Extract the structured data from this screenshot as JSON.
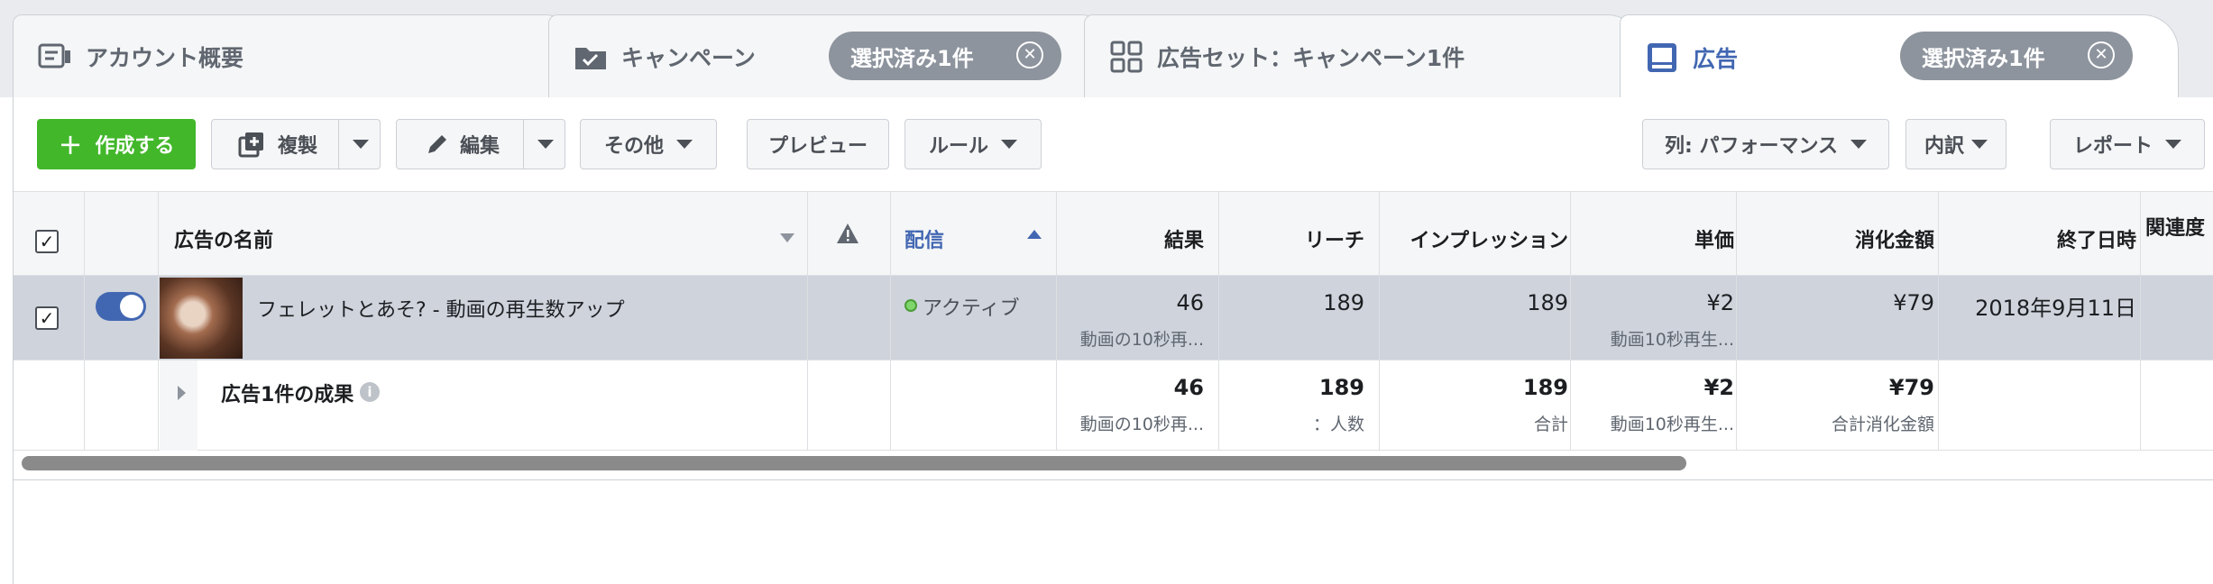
{
  "tabs": [
    {
      "label": "アカウント概要"
    },
    {
      "label": "キャンペーン",
      "pill": "選択済み1件"
    },
    {
      "label": "広告セット：キャンペーン1件"
    },
    {
      "label": "広告",
      "pill": "選択済み1件"
    }
  ],
  "toolbar": {
    "create": "作成する",
    "duplicate": "複製",
    "edit": "編集",
    "more": "その他",
    "preview": "プレビュー",
    "rules": "ルール",
    "columns": "列: パフォーマンス",
    "breakdown": "内訳",
    "report": "レポート"
  },
  "table": {
    "headers": {
      "name": "広告の名前",
      "delivery": "配信",
      "results": "結果",
      "reach": "リーチ",
      "impressions": "インプレッション",
      "cost": "単価",
      "spend": "消化金額",
      "end": "終了日時",
      "related": "関連度"
    },
    "row": {
      "name": "フェレットとあそ? - 動画の再生数アップ",
      "delivery": "アクティブ",
      "results": "46",
      "results_sub": "動画の10秒再...",
      "reach": "189",
      "impressions": "189",
      "cost": "¥2",
      "cost_sub": "動画10秒再生...",
      "spend": "¥79",
      "end": "2018年9月11日"
    },
    "summary": {
      "label": "広告1件の成果",
      "results": "46",
      "results_sub": "動画の10秒再...",
      "reach": "189",
      "reach_sub": "：人数",
      "impressions": "189",
      "impressions_sub": "合計",
      "cost": "¥2",
      "cost_sub": "動画10秒再生...",
      "spend": "¥79",
      "spend_sub": "合計消化金額"
    }
  },
  "colors": {
    "accent": "#4267b2",
    "primary_button": "#42b72a",
    "selected_row": "#ced3dc",
    "active_dot": "#5cb85c"
  }
}
